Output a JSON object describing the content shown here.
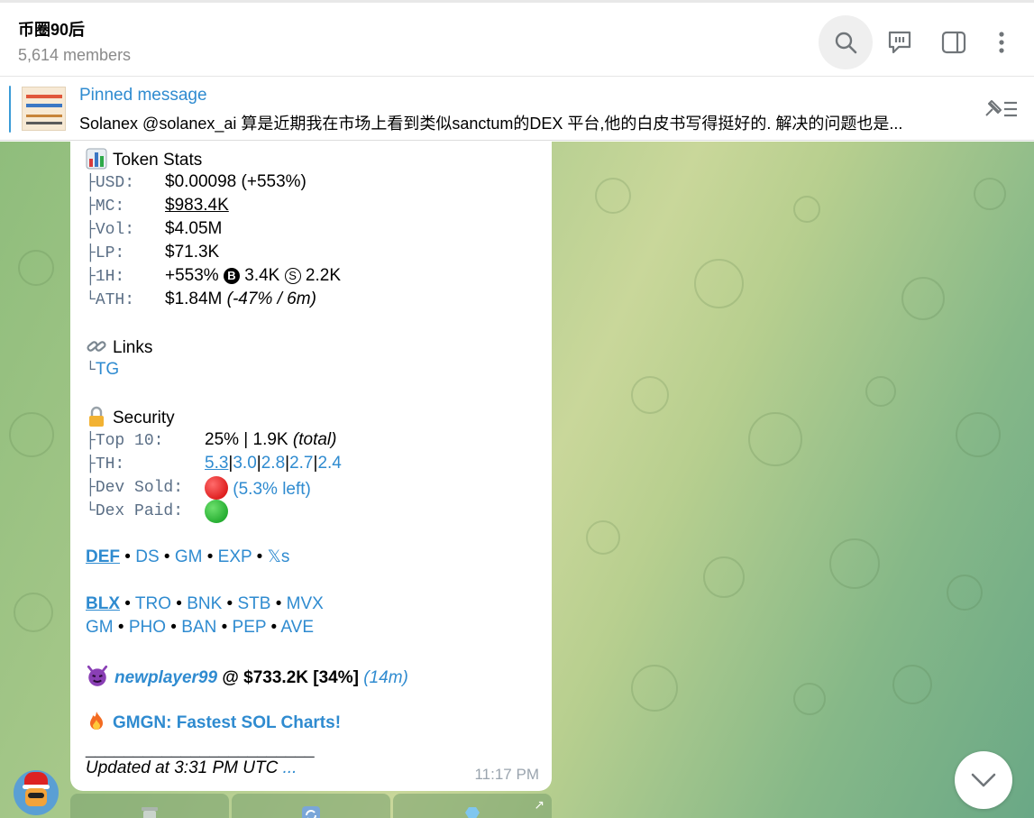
{
  "header": {
    "title": "币圈90后",
    "subtitle": "5,614 members",
    "icons": [
      "search-icon",
      "reactions-icon",
      "sidebar-icon",
      "more-icon"
    ]
  },
  "pinned": {
    "title": "Pinned message",
    "text": "Solanex @solanex_ai 算是近期我在市场上看到类似sanctum的DEX 平台,他的白皮书写得挺好的. 解决的问题也是..."
  },
  "message": {
    "token_stats": {
      "heading": "Token Stats",
      "usd_label": "USD:",
      "usd_value": "$0.00098",
      "usd_change": "(+553%)",
      "mc_label": "MC:",
      "mc_value": "$983.4K",
      "vol_label": "Vol:",
      "vol_value": "$4.05M",
      "lp_label": "LP:",
      "lp_value": "$71.3K",
      "h1_label": "1H:",
      "h1_change": "+553%",
      "h1_buy_symbol": "B",
      "h1_buy": "3.4K",
      "h1_sell_symbol": "S",
      "h1_sell": "2.2K",
      "ath_label": "ATH:",
      "ath_value": "$1.84M",
      "ath_note": "(-47% / 6m)"
    },
    "links": {
      "heading": "Links",
      "tg": "TG"
    },
    "security": {
      "heading": "Security",
      "top10_label": "Top 10:",
      "top10_value": "25% | 1.9K",
      "top10_note": "(total)",
      "th_label": "TH:",
      "th_values": [
        "5.3",
        "3.0",
        "2.8",
        "2.7",
        "2.4"
      ],
      "dev_sold_label": "Dev Sold:",
      "dev_sold_value": "(5.3% left)",
      "dex_paid_label": "Dex Paid:"
    },
    "links_row1": [
      "DEF",
      "DS",
      "GM",
      "EXP",
      "𝕏s"
    ],
    "links_row2": [
      "BLX",
      "TRO",
      "BNK",
      "STB",
      "MVX"
    ],
    "links_row3": [
      "GM",
      "PHO",
      "BAN",
      "PEP",
      "AVE"
    ],
    "player": {
      "name": "newplayer99",
      "value": "@ $733.2K [34%]",
      "ago": "(14m)"
    },
    "promo": "GMGN: Fastest SOL Charts!",
    "divider": "________________________",
    "updated": "Updated at 3:31 PM UTC",
    "updated_more": "...",
    "time": "11:17 PM"
  },
  "colors": {
    "accent": "#2f8bd0",
    "mono": "#5b6f86",
    "timestamp": "#9aa4ae"
  }
}
